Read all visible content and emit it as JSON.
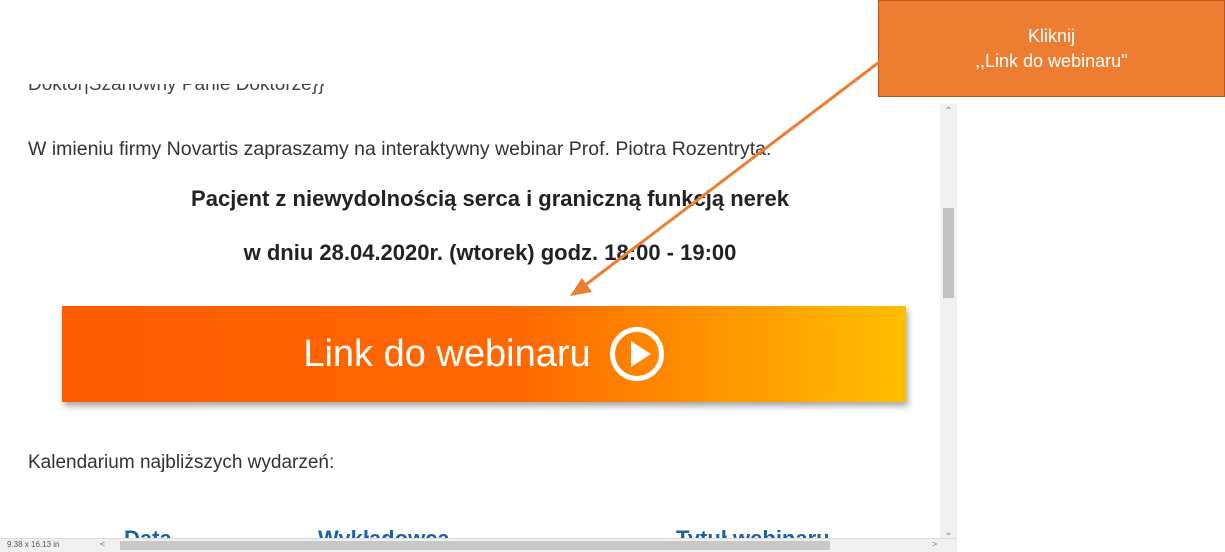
{
  "email": {
    "greeting_partial": "Doktor|Szanowny Panie Doktorze}}",
    "intro": "W imieniu firmy Novartis zapraszamy na interaktywny webinar Prof. Piotra Rozentryta:",
    "title_line1": "Pacjent z niewydolnością serca i graniczną funkcją nerek",
    "title_line2": "w dniu 28.04.2020r. (wtorek) godz. 18:00 - 19:00",
    "webinar_button_label": "Link do webinaru",
    "calendar_label": "Kalendarium najbliższych wydarzeń:",
    "table_headers": [
      "Data",
      "Wykładowca",
      "Tytuł webinaru"
    ]
  },
  "statusbar": {
    "page_size": "9.38 x 16.13 in"
  },
  "annotation": {
    "line1": "Kliknij",
    "line2": ",,Link do webinaru''"
  },
  "colors": {
    "callout_bg": "#ed7d31",
    "button_gradient_start": "#ff5a00",
    "button_gradient_end": "#ffbf00",
    "table_header": "#1f5fa8"
  },
  "icons": {
    "button_icon": "play-circle-icon"
  }
}
